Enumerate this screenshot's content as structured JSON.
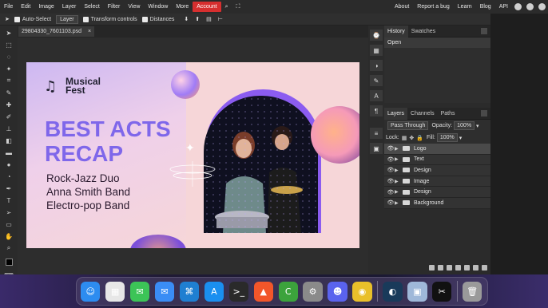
{
  "menubar": {
    "items": [
      "File",
      "Edit",
      "Image",
      "Layer",
      "Select",
      "Filter",
      "View",
      "Window",
      "More"
    ],
    "account": "Account",
    "right": [
      "About",
      "Report a bug",
      "Learn",
      "Blog",
      "API"
    ]
  },
  "options": {
    "auto_select": "Auto-Select",
    "layer_select": "Layer",
    "transform": "Transform controls",
    "distances": "Distances"
  },
  "document": {
    "tab_name": "29804330_7601103.psd",
    "close": "×"
  },
  "poster": {
    "logo": "Musical\nFest",
    "headline": "BEST ACTS\nRECAP",
    "acts": [
      "Rock-Jazz Duo",
      "Anna Smith Band",
      "Electro-pop Band"
    ],
    "colors": {
      "accent": "#7f67ea",
      "background": "#f6d6d8",
      "arch": "#8b5cf0"
    }
  },
  "history": {
    "tabs": [
      "History",
      "Swatches"
    ],
    "items": [
      "Open"
    ]
  },
  "layers": {
    "tabs": [
      "Layers",
      "Channels",
      "Paths"
    ],
    "blend_mode": "Pass Through",
    "opacity_label": "Opacity:",
    "opacity": "100%",
    "lock_label": "Lock:",
    "fill_label": "Fill:",
    "fill": "100%",
    "items": [
      "Logo",
      "Text",
      "Design",
      "Image",
      "Design",
      "Background"
    ]
  },
  "dock": {
    "apps": [
      {
        "name": "finder",
        "glyph": "☺",
        "color": "#2d8cf0"
      },
      {
        "name": "launchpad",
        "glyph": "▦",
        "color": "#e7e7e7"
      },
      {
        "name": "messages",
        "glyph": "✉",
        "color": "#3cc457"
      },
      {
        "name": "mail",
        "glyph": "✉",
        "color": "#3a8df5"
      },
      {
        "name": "vscode",
        "glyph": "⌘",
        "color": "#1f7fd1"
      },
      {
        "name": "app-store",
        "glyph": "A",
        "color": "#1a8ff0"
      },
      {
        "name": "terminal",
        "glyph": ">_",
        "color": "#2a2a2a"
      },
      {
        "name": "brave",
        "glyph": "▲",
        "color": "#f2562a"
      },
      {
        "name": "coda",
        "glyph": "C",
        "color": "#3ca33c"
      },
      {
        "name": "settings",
        "glyph": "⚙",
        "color": "#8a8a8a"
      },
      {
        "name": "discord",
        "glyph": "☻",
        "color": "#5a63ee"
      },
      {
        "name": "chrome",
        "glyph": "◉",
        "color": "#e9c02a"
      },
      {
        "name": "steam",
        "glyph": "◐",
        "color": "#193a5a"
      },
      {
        "name": "preview",
        "glyph": "▣",
        "color": "#9fb8d9"
      },
      {
        "name": "capcut",
        "glyph": "✂",
        "color": "#111111"
      },
      {
        "name": "trash",
        "glyph": "🗑",
        "color": "#9a9a9a"
      }
    ]
  }
}
